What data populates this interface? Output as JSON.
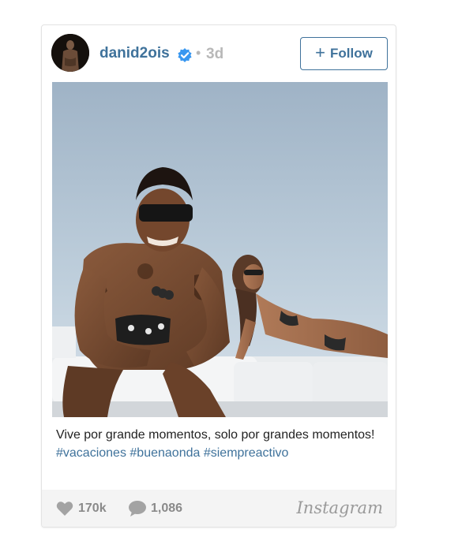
{
  "post": {
    "username": "danid2ois",
    "separator": "•",
    "time_ago": "3d",
    "follow": {
      "plus": "+",
      "label": "Follow"
    },
    "caption": {
      "text": "Vive por grande momentos, solo por grandes momentos!",
      "hashtags": [
        "#vacaciones",
        "#buenaonda",
        "#siempreactivo"
      ]
    },
    "stats": {
      "likes": "170k",
      "comments": "1,086"
    },
    "brand": "Instagram"
  },
  "colors": {
    "accent": "#3f729b",
    "verified": "#3897f0",
    "muted": "#8a8a8a",
    "footer_bg": "#f4f4f4"
  },
  "icons": {
    "verified": "verified-badge-icon",
    "likes": "heart-icon",
    "comments": "speech-bubble-icon"
  }
}
